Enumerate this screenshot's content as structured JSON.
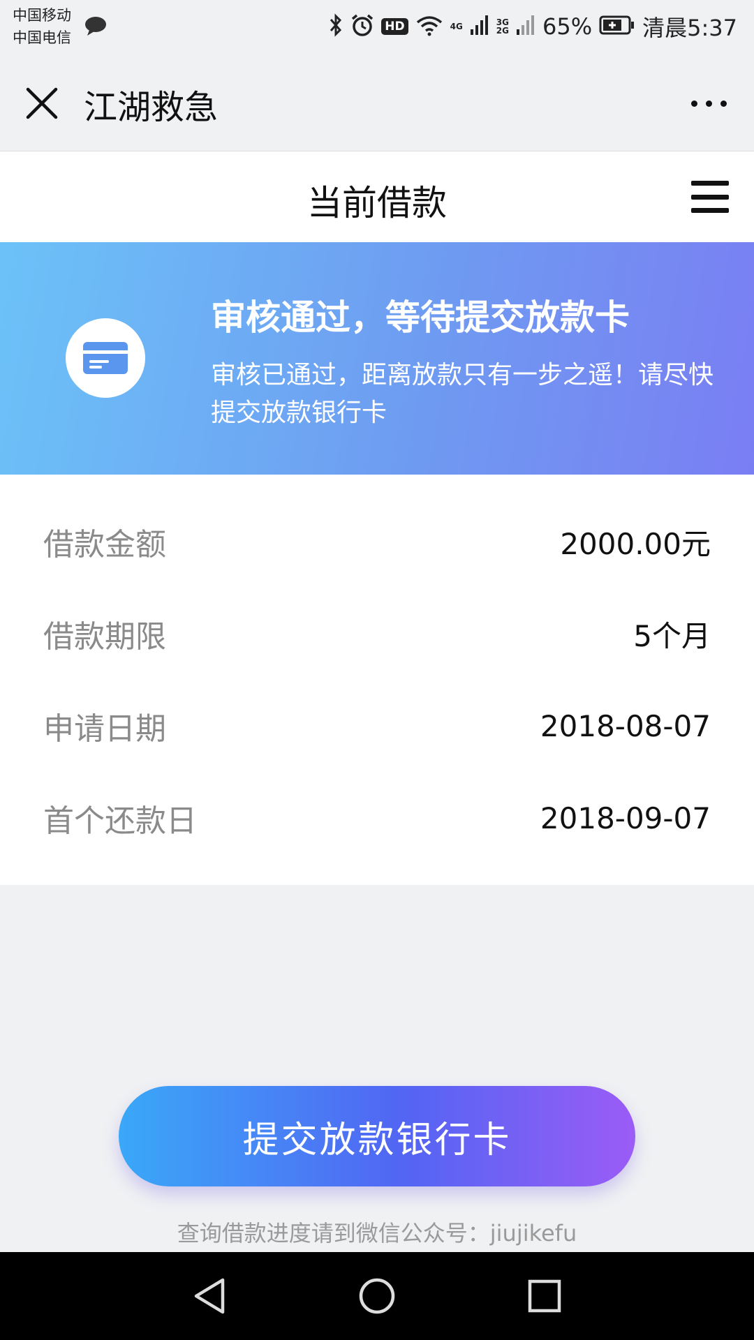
{
  "status_bar": {
    "carrier1": "中国移动",
    "carrier2": "中国电信",
    "hd": "HD",
    "net1": "4G",
    "net2a": "3G",
    "net2b": "2G",
    "battery": "65%",
    "time": "清晨5:37"
  },
  "header": {
    "title": "江湖救急"
  },
  "page": {
    "title": "当前借款"
  },
  "banner": {
    "title": "审核通过，等待提交放款卡",
    "description": "审核已通过，距离放款只有一步之遥！请尽快提交放款银行卡"
  },
  "details": [
    {
      "label": "借款金额",
      "value": "2000.00元"
    },
    {
      "label": "借款期限",
      "value": "5个月"
    },
    {
      "label": "申请日期",
      "value": "2018-08-07"
    },
    {
      "label": "首个还款日",
      "value": "2018-09-07"
    }
  ],
  "actions": {
    "submit_label": "提交放款银行卡"
  },
  "footer": {
    "note": "查询借款进度请到微信公众号：jiujikefu"
  },
  "colors": {
    "banner_start": "#6cc2f8",
    "banner_end": "#7a7ef3",
    "button_start": "#3aa8f8",
    "button_end": "#9b5cf6"
  },
  "icons": [
    "message-bubble-icon",
    "bluetooth-icon",
    "alarm-icon",
    "wifi-icon",
    "signal-icon",
    "battery-icon",
    "close-icon",
    "more-icon",
    "menu-icon",
    "card-icon",
    "back-icon",
    "home-icon",
    "recents-icon"
  ]
}
